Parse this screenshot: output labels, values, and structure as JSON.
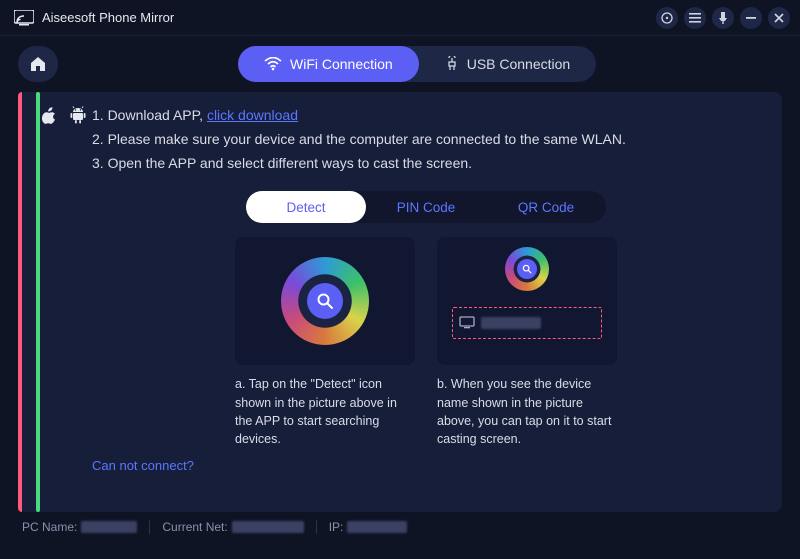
{
  "app": {
    "title": "Aiseesoft Phone Mirror"
  },
  "window_controls": [
    {
      "name": "feedback-icon"
    },
    {
      "name": "menu-icon"
    },
    {
      "name": "pin-icon"
    },
    {
      "name": "minimize-icon"
    },
    {
      "name": "close-icon"
    }
  ],
  "conn_tabs": {
    "wifi": "WiFi Connection",
    "usb": "USB Connection"
  },
  "steps": {
    "s1_prefix": "1. Download APP, ",
    "s1_link": "click download",
    "s2": "2. Please make sure your device and the computer are connected to the same WLAN.",
    "s3": "3. Open the APP and select different ways to cast the screen."
  },
  "method_tabs": {
    "detect": "Detect",
    "pin": "PIN Code",
    "qr": "QR Code"
  },
  "captions": {
    "a": "a. Tap on the \"Detect\" icon shown in the picture above in the APP to start searching devices.",
    "b": "b. When you see the device name shown in the picture above, you can tap on it to start casting screen."
  },
  "help": {
    "cannot_connect": "Can not connect?"
  },
  "status": {
    "pc_label": "PC Name:",
    "net_label": "Current Net:",
    "ip_label": "IP:"
  }
}
